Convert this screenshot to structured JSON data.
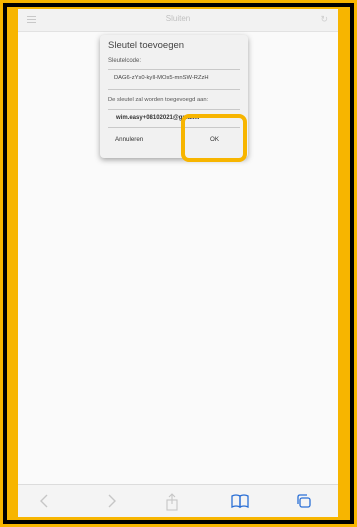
{
  "topbar": {
    "title": "Sluiten",
    "menu_icon": "hamburger-icon",
    "reload_icon": "reload-icon"
  },
  "dialog": {
    "title": "Sleutel toevoegen",
    "key_label": "Sleutelcode:",
    "key_value": "DAG6-zYs0-kyIl-MOs5-mnSW-RZzH",
    "target_label": "De sleutel zal worden toegevoegd aan:",
    "account": "wim.easy+08102021@gmail...",
    "cancel_label": "Annuleren",
    "ok_label": "OK"
  },
  "bottombar": {
    "icons": [
      "back-icon",
      "forward-icon",
      "share-icon",
      "bookmarks-icon",
      "tabs-icon"
    ]
  },
  "colors": {
    "highlight": "#f7b500",
    "accent_blue": "#2a6fd6"
  }
}
